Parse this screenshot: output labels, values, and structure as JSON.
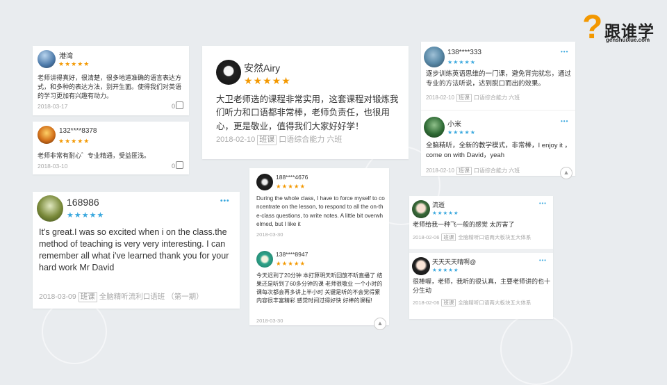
{
  "brand": {
    "name": "跟谁学",
    "domain": "genshuixue.com",
    "accent": "#f39800"
  },
  "star_colors": {
    "orange": "#f39800",
    "blue": "#3aa8de"
  },
  "reviews": [
    {
      "user": "港湾",
      "stars": "★★★★★",
      "text": "老师讲得真好，很清楚，很多地道准确的语言表达方式，和多种的表达方法，别开生面。使得我们对英语的学习更加有兴趣有动力。",
      "date": "2018-03-17",
      "likes": "0"
    },
    {
      "user": "132****8378",
      "stars": "★★★★★",
      "text": "老师非常有耐心゛专业精通，受益匪浅。",
      "date": "2018-03-10",
      "likes": "0"
    },
    {
      "user": "安然Airy",
      "stars": "★★★★★",
      "text": "大卫老师选的课程非常实用，这套课程对锻炼我们听力和口语都非常棒，老师负责任，也很用心，更是敬业，值得我们大家好好学！",
      "date": "2018-02-10",
      "tag": "班课",
      "course": "口语综合能力 六班"
    },
    {
      "user": "168986",
      "stars": "★★★★★",
      "text": "It's great.I was so excited when i on the class.the method of teaching is very very interesting. I can remember all what i've learned thank you for your hard work Mr David",
      "date": "2018-03-09",
      "tag": "班课",
      "course": "全脑精听流利口语班 （第一期）",
      "more": "•••"
    },
    {
      "user": "188****4676",
      "stars": "★★★★★",
      "text": "During the whole class, I have to force myself to concentrate on the lesson, to respond to all the on-the-class questions, to write notes. A little bit overwhelmed, but I like it",
      "date": "2018-03-30"
    },
    {
      "user": "138****8947",
      "stars": "★★★★★",
      "text": "今天迟到了20分钟 本打算明天听回放不听直播了 结果还是听到了60多分钟的课 老师很敬业 一个小时的课每次都会再多讲上半小时 关键是听的不会觉得累 内容很丰富精彩 感觉时间过得好快 好棒的课程!",
      "date": "2018-03-30"
    },
    {
      "user": "138****333",
      "stars": "★★★★★",
      "text": "逐步训练英语思维的一门课，避免背完就忘，通过专业的方法听说，达到脱口而出的效果。",
      "date": "2018-02-10",
      "tag": "班课",
      "course": "口语综合能力 六班",
      "more": "•••"
    },
    {
      "user": "小米",
      "stars": "★★★★★",
      "text": "全脑精听，全新的教学模式，非常棒，I enjoy it ，come on with David，yeah",
      "date": "2018-02-10",
      "tag": "班课",
      "course": "口语综合能力 六班",
      "more": "•••"
    },
    {
      "user": "流逝",
      "stars": "★★★★★",
      "text": "老师给我一种飞一般的感觉 太厉害了",
      "date": "2018-02-06",
      "tag": "班课",
      "course": "全脑精听口语两大板块五大体系",
      "more": "•••"
    },
    {
      "user": "天天天天晴啊@",
      "stars": "★★★★★",
      "text": "很棒喔，老师，我听的很认真，主要老师讲的也十分生动",
      "date": "2018-02-06",
      "tag": "班课",
      "course": "全脑精听口语两大板块五大体系",
      "more": "•••"
    }
  ]
}
